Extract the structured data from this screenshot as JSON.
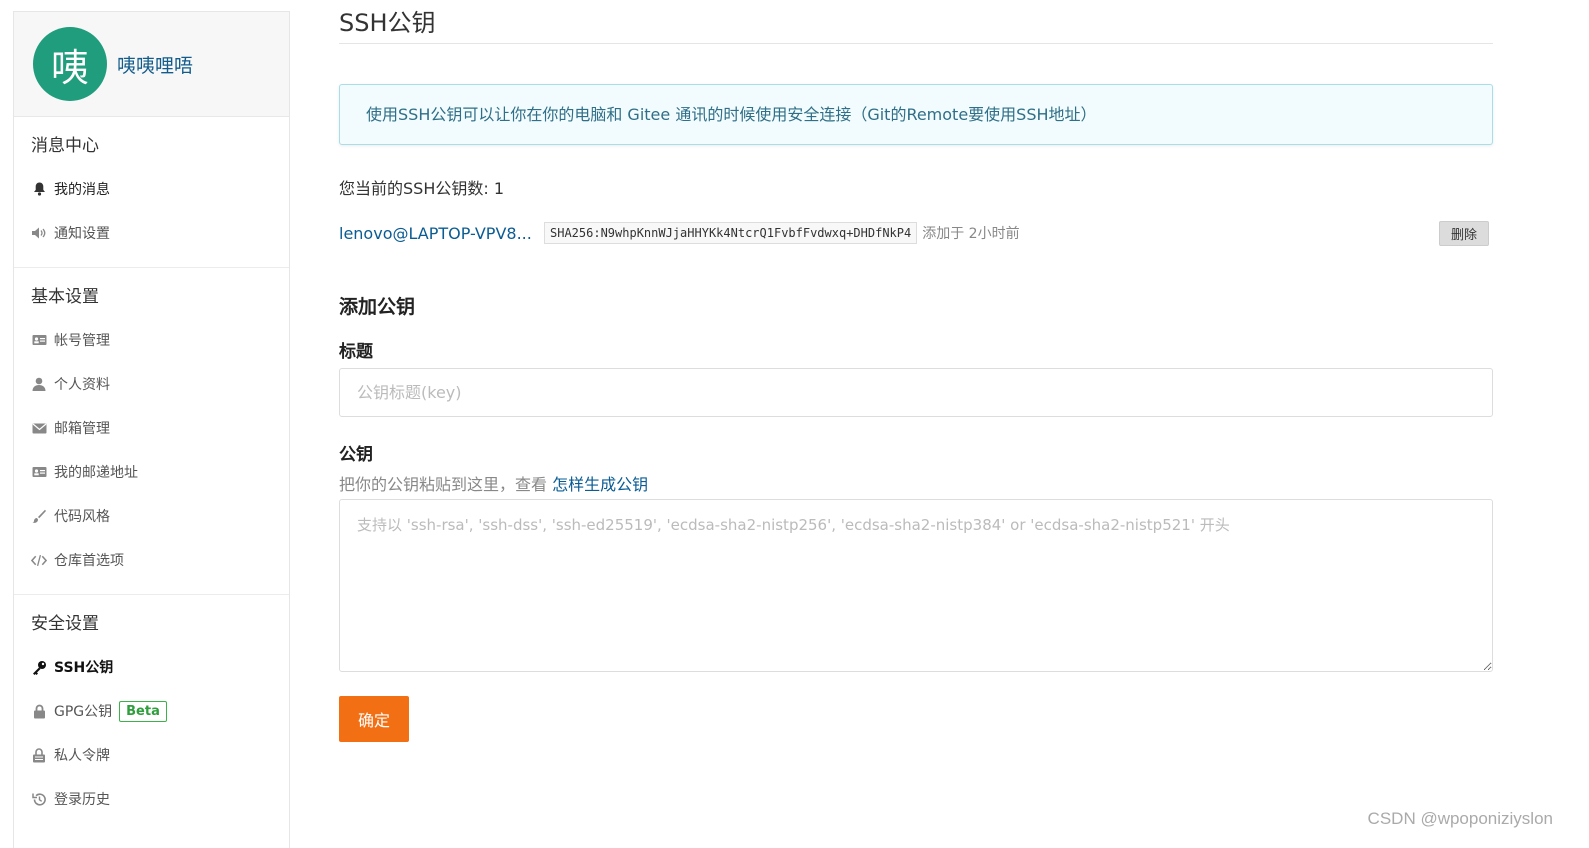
{
  "profile": {
    "avatar_char": "咦",
    "username": "咦咦哩唔"
  },
  "sidebar": {
    "sections": [
      {
        "title": "消息中心",
        "items": [
          {
            "label": "我的消息",
            "icon": "bell-icon"
          },
          {
            "label": "通知设置",
            "icon": "volume-icon"
          }
        ]
      },
      {
        "title": "基本设置",
        "items": [
          {
            "label": "帐号管理",
            "icon": "id-card-icon"
          },
          {
            "label": "个人资料",
            "icon": "user-icon"
          },
          {
            "label": "邮箱管理",
            "icon": "envelope-icon"
          },
          {
            "label": "我的邮递地址",
            "icon": "address-card-icon"
          },
          {
            "label": "代码风格",
            "icon": "brush-icon"
          },
          {
            "label": "仓库首选项",
            "icon": "code-icon"
          }
        ]
      },
      {
        "title": "安全设置",
        "items": [
          {
            "label": "SSH公钥",
            "icon": "key-icon",
            "active": true
          },
          {
            "label": "GPG公钥",
            "icon": "lock-icon",
            "badge": "Beta"
          },
          {
            "label": "私人令牌",
            "icon": "lock-open-icon"
          },
          {
            "label": "登录历史",
            "icon": "history-icon"
          }
        ]
      }
    ]
  },
  "main": {
    "title": "SSH公钥",
    "info": "使用SSH公钥可以让你在你的电脑和 Gitee 通讯的时候使用安全连接（Git的Remote要使用SSH地址）",
    "count_text": "您当前的SSH公钥数: 1",
    "keys": [
      {
        "title": "lenovo@LAPTOP-VPV8...",
        "fingerprint": "SHA256:N9whpKnnWJjaHHYKk4NtcrQ1FvbfFvdwxq+DHDfNkP4",
        "added": "添加于 2小时前",
        "delete_label": "删除"
      }
    ],
    "add_heading": "添加公钥",
    "title_label": "标题",
    "title_placeholder": "公钥标题(key)",
    "key_label": "公钥",
    "hint_prefix": "把你的公钥粘贴到这里，查看",
    "hint_link": "怎样生成公钥",
    "key_placeholder": "支持以 'ssh-rsa', 'ssh-dss', 'ssh-ed25519', 'ecdsa-sha2-nistp256', 'ecdsa-sha2-nistp384' or 'ecdsa-sha2-nistp521' 开头",
    "submit_label": "确定"
  },
  "watermark": "CSDN @wpoponiziyslon",
  "colors": {
    "accent": "#f36f13",
    "avatar": "#1f9d7c",
    "link": "#0a5c93",
    "beta": "#3cb34a"
  }
}
